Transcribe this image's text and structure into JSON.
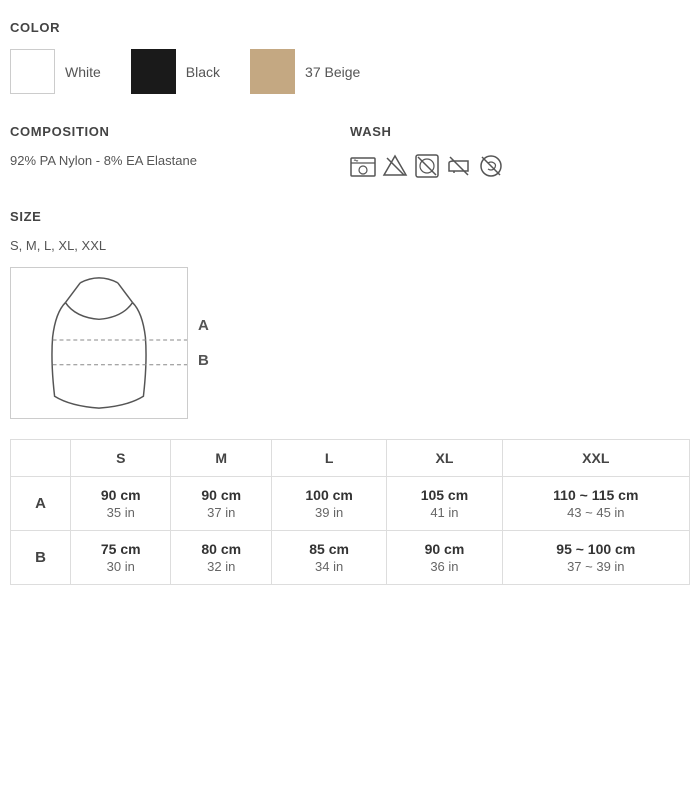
{
  "color": {
    "title": "COLOR",
    "swatches": [
      {
        "id": "white",
        "label": "White",
        "bg": "#ffffff",
        "border": "#ccc"
      },
      {
        "id": "black",
        "label": "Black",
        "bg": "#1a1a1a",
        "border": "#1a1a1a"
      },
      {
        "id": "beige",
        "label": "37 Beige",
        "bg": "#c4a882",
        "border": "#c4a882"
      }
    ]
  },
  "composition": {
    "title": "COMPOSITION",
    "text": "92% PA Nylon  - 8% EA Elastane"
  },
  "wash": {
    "title": "WASH",
    "icons": [
      "wash",
      "no-bleach",
      "no-tumble",
      "no-iron",
      "no-dry-clean"
    ]
  },
  "size": {
    "title": "SIZE",
    "available": "S, M, L, XL, XXL",
    "labels": [
      "A",
      "B"
    ],
    "columns": [
      "S",
      "M",
      "L",
      "XL",
      "XXL"
    ],
    "rows": [
      {
        "label": "A",
        "values": [
          {
            "cm": "90",
            "in": "35"
          },
          {
            "cm": "90",
            "in": "37"
          },
          {
            "cm": "100",
            "in": "39"
          },
          {
            "cm": "105",
            "in": "41"
          },
          {
            "cm": "110 ~ 115",
            "in": "43 ~ 45"
          }
        ]
      },
      {
        "label": "B",
        "values": [
          {
            "cm": "75",
            "in": "30"
          },
          {
            "cm": "80",
            "in": "32"
          },
          {
            "cm": "85",
            "in": "34"
          },
          {
            "cm": "90",
            "in": "36"
          },
          {
            "cm": "95 ~ 100",
            "in": "37 ~ 39"
          }
        ]
      }
    ]
  }
}
